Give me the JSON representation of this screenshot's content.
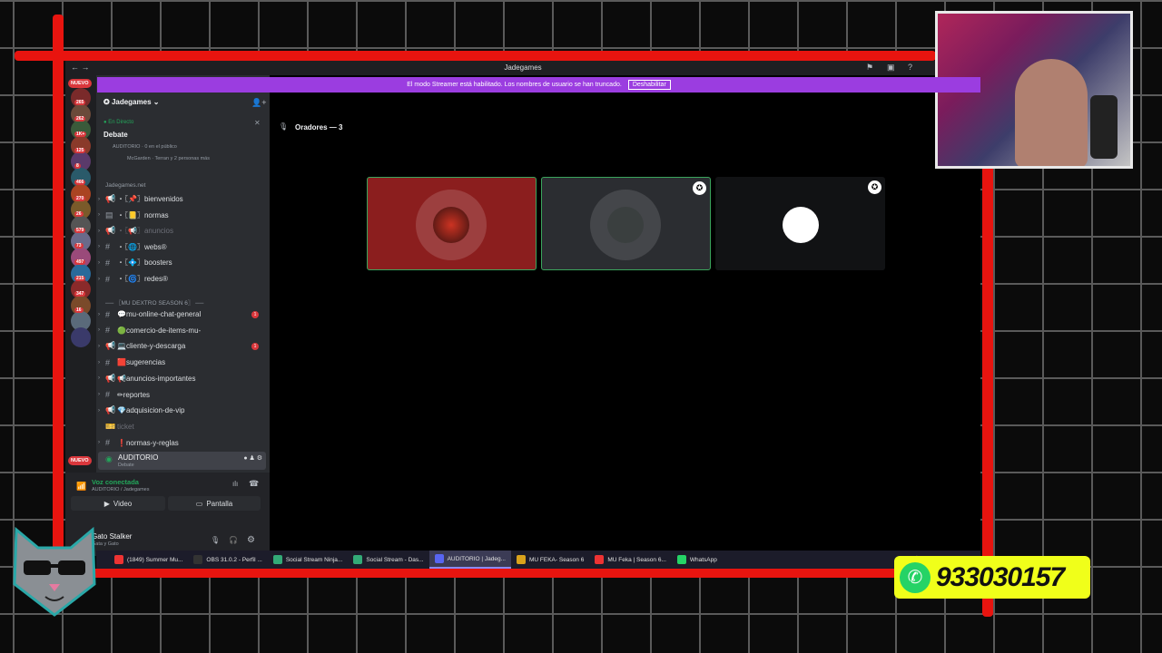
{
  "app": {
    "title": "Jadegames",
    "window_icons": [
      "flag-icon",
      "inbox-icon",
      "help-icon"
    ]
  },
  "banner": {
    "text": "El modo Streamer está habilitado. Los nombres de usuario se han truncado.",
    "button": "Deshabilitar",
    "color": "#9b3de0"
  },
  "guilds": {
    "new_top": "NUEVO",
    "new_bottom": "NUEVO",
    "badges": [
      "265",
      "262",
      "1K+",
      "125",
      "8",
      "466",
      "270",
      "26",
      "579",
      "73",
      "497",
      "215",
      "347",
      "16"
    ]
  },
  "server": {
    "name": "Jadegames",
    "live_label": "En Directo",
    "stage_title": "Debate",
    "stage_info": "AUDITORIO · 0 en el público",
    "stage_people": "McGarden · Terran y 2 personas más"
  },
  "categories": {
    "first": "Jadegames.net",
    "second": "── 〖MU DEXTRO SEASON 6〗 ──"
  },
  "channels": [
    {
      "name": "bienvenidos",
      "prefix": "・〖📌〗",
      "type": "announce",
      "muted": false
    },
    {
      "name": "normas",
      "prefix": "・〖📒〗",
      "type": "rules",
      "muted": false
    },
    {
      "name": "anuncios",
      "prefix": "・〖📢〗",
      "type": "announce",
      "muted": true
    },
    {
      "name": "webs®",
      "prefix": "・〖🌐〗",
      "type": "text",
      "muted": false
    },
    {
      "name": "boosters",
      "prefix": "・〖💠〗",
      "type": "text",
      "muted": false
    },
    {
      "name": "redes®",
      "prefix": "・〖🌀〗",
      "type": "text",
      "muted": false
    }
  ],
  "channels2": [
    {
      "name": "mu-online-chat-general",
      "prefix": "💬",
      "type": "text",
      "badge": "1"
    },
    {
      "name": "comercio-de-items-mu-",
      "prefix": "🟢",
      "type": "text",
      "badge": ""
    },
    {
      "name": "cliente-y-descarga",
      "prefix": "💻",
      "type": "announce",
      "badge": "1"
    },
    {
      "name": "sugerencias",
      "prefix": "🟥",
      "type": "text",
      "badge": ""
    },
    {
      "name": "anuncios-importantes",
      "prefix": "📢",
      "type": "announce",
      "badge": ""
    },
    {
      "name": "reportes",
      "prefix": "✏",
      "type": "text",
      "badge": ""
    },
    {
      "name": "adquisicion-de-vip",
      "prefix": "💎",
      "type": "announce",
      "badge": ""
    },
    {
      "name": "ticket",
      "prefix": "",
      "type": "ticket",
      "badge": ""
    },
    {
      "name": "normas-y-reglas",
      "prefix": "❗",
      "type": "text",
      "badge": ""
    }
  ],
  "voice_channel": {
    "name": "AUDITORIO",
    "sub": "Debate"
  },
  "voice_status": {
    "title": "Voz conectada",
    "location": "AUDITORIO / Jadegames",
    "video": "Video",
    "screen": "Pantalla"
  },
  "user": {
    "name": "Gato Stalker",
    "status": "Gata y Gato"
  },
  "stage": {
    "speakers_label": "Oradores — 3"
  },
  "taskbar": [
    {
      "label": "(1849) Summer Mu...",
      "color": "#e33"
    },
    {
      "label": "OBS 31.0.2 - Perfil ...",
      "color": "#333"
    },
    {
      "label": "Social Stream Ninja...",
      "color": "#3a7"
    },
    {
      "label": "Social Stream - Das...",
      "color": "#3a7"
    },
    {
      "label": "AUDITORIO | Jadeg...",
      "color": "#5865f2",
      "active": true
    },
    {
      "label": "MU FEKA- Season 6",
      "color": "#d9a21b"
    },
    {
      "label": "MU Feka | Season 6...",
      "color": "#e33"
    },
    {
      "label": "WhatsApp",
      "color": "#25d366"
    }
  ],
  "phone": {
    "number": "933030157"
  }
}
